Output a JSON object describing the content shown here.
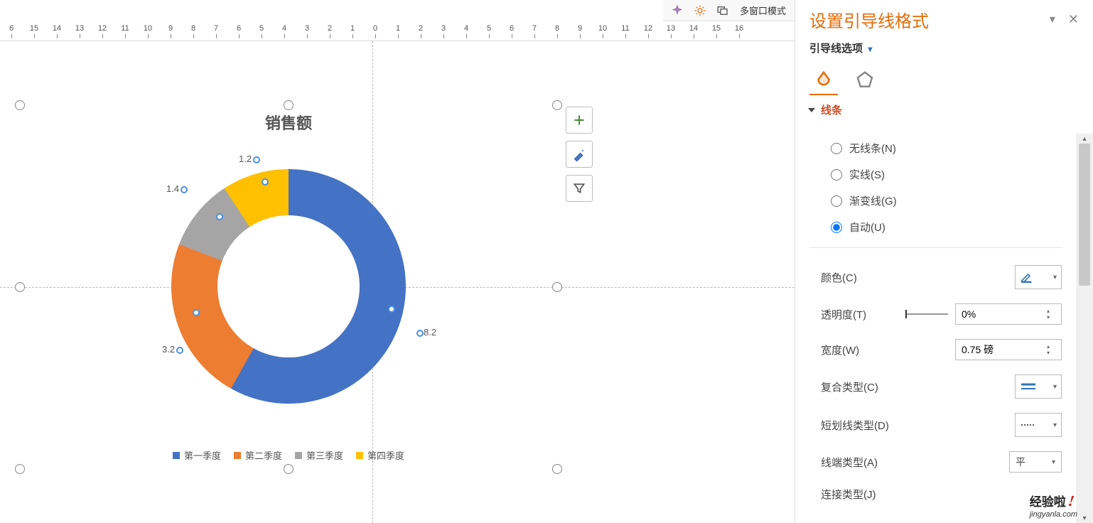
{
  "top_toolbar": {
    "multi_window": "多窗口模式"
  },
  "ruler_labels": [
    "6",
    "15",
    "14",
    "13",
    "12",
    "11",
    "10",
    "9",
    "8",
    "7",
    "6",
    "5",
    "4",
    "3",
    "2",
    "1",
    "0",
    "1",
    "2",
    "3",
    "4",
    "5",
    "6",
    "7",
    "8",
    "9",
    "10",
    "11",
    "12",
    "13",
    "14",
    "15",
    "16"
  ],
  "chart": {
    "title": "销售额",
    "legend": [
      "第一季度",
      "第二季度",
      "第三季度",
      "第四季度"
    ],
    "colors": [
      "#4472c4",
      "#ed7d31",
      "#a5a5a5",
      "#ffc000"
    ],
    "labels": {
      "q1": "8.2",
      "q2": "3.2",
      "q3": "1.4",
      "q4": "1.2"
    }
  },
  "chart_data": {
    "type": "pie",
    "title": "销售额",
    "categories": [
      "第一季度",
      "第二季度",
      "第三季度",
      "第四季度"
    ],
    "values": [
      8.2,
      3.2,
      1.4,
      1.2
    ],
    "series": [
      {
        "name": "销售额",
        "values": [
          8.2,
          3.2,
          1.4,
          1.2
        ]
      }
    ],
    "colors": [
      "#4472c4",
      "#ed7d31",
      "#a5a5a5",
      "#ffc000"
    ],
    "legend_position": "bottom",
    "donut": true
  },
  "panel": {
    "title": "设置引导线格式",
    "sub_label": "引导线选项",
    "section": "线条",
    "radios": {
      "none": "无线条(N)",
      "solid": "实线(S)",
      "gradient": "渐变线(G)",
      "auto": "自动(U)"
    },
    "props": {
      "color": "颜色(C)",
      "transparency": "透明度(T)",
      "transparency_val": "0%",
      "width": "宽度(W)",
      "width_val": "0.75 磅",
      "compound": "复合类型(C)",
      "dash": "短划线类型(D)",
      "cap": "线端类型(A)",
      "cap_val": "平",
      "join": "连接类型(J)"
    }
  },
  "watermark": {
    "brand": "经验啦",
    "url": "jingyanla.com"
  }
}
